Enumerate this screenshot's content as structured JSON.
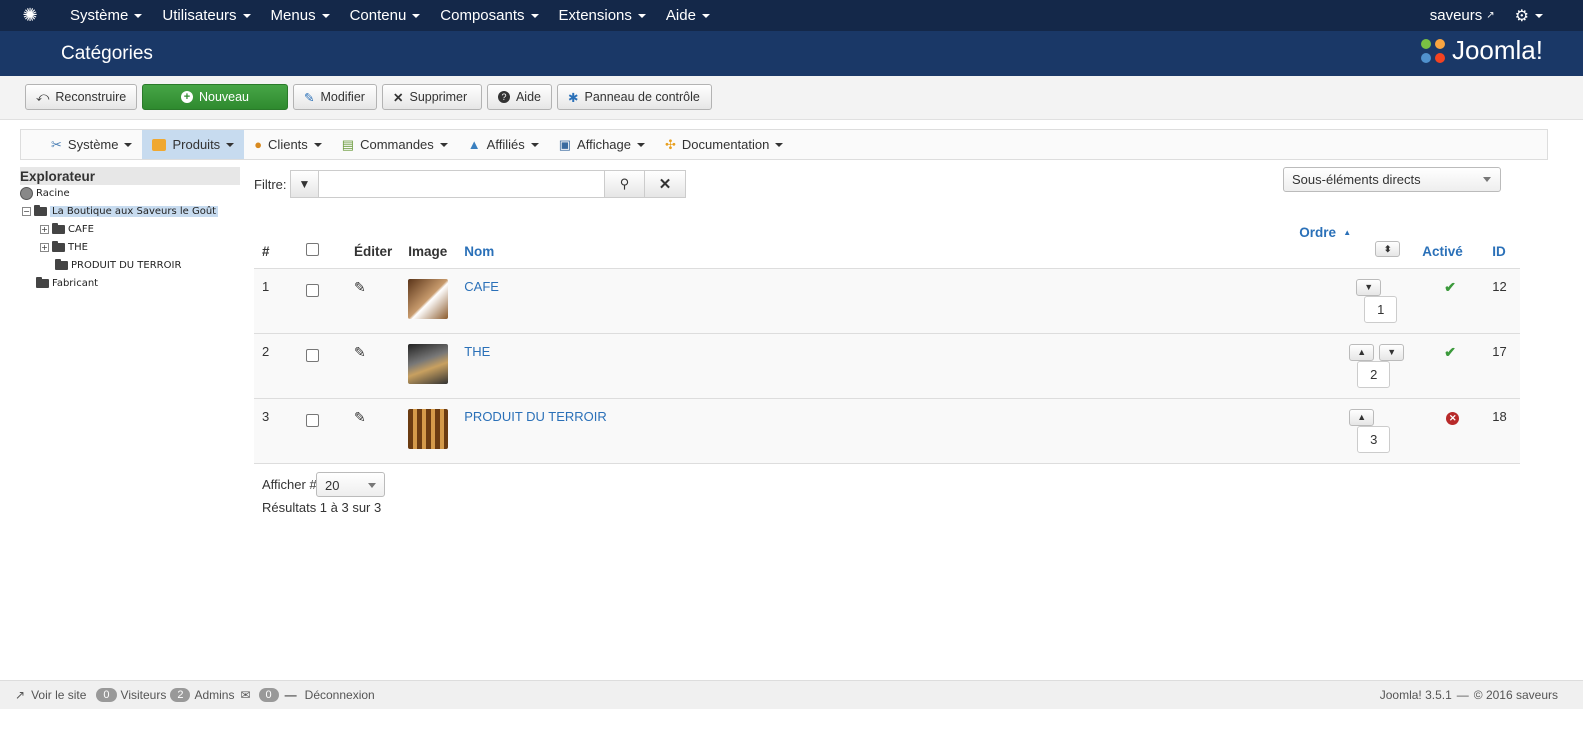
{
  "nav": {
    "items": [
      "Système",
      "Utilisateurs",
      "Menus",
      "Contenu",
      "Composants",
      "Extensions",
      "Aide"
    ],
    "site": "saveurs"
  },
  "header": {
    "title": "Catégories",
    "brand": "Joomla!"
  },
  "toolbar": {
    "rebuild": "Reconstruire",
    "new": "Nouveau",
    "edit": "Modifier",
    "delete": "Supprimer",
    "help": "Aide",
    "panel": "Panneau de contrôle"
  },
  "submenu": [
    "Système",
    "Produits",
    "Clients",
    "Commandes",
    "Affiliés",
    "Affichage",
    "Documentation"
  ],
  "sidebar": {
    "title": "Explorateur",
    "root": "Racine",
    "shop": "La Boutique aux Saveurs le Goût",
    "children": [
      "CAFE",
      "THE",
      "PRODUIT DU TERROIR"
    ],
    "maker": "Fabricant"
  },
  "filter": {
    "label": "Filtre:",
    "value": ""
  },
  "select": {
    "selected": "Sous-éléments directs"
  },
  "table": {
    "headers": {
      "num": "#",
      "edit": "Éditer",
      "image": "Image",
      "name": "Nom",
      "order": "Ordre",
      "active": "Activé",
      "id": "ID"
    },
    "rows": [
      {
        "num": "1",
        "name": "CAFE",
        "order": "1",
        "id": "12",
        "active": true
      },
      {
        "num": "2",
        "name": "THE",
        "order": "2",
        "id": "17",
        "active": true
      },
      {
        "num": "3",
        "name": "PRODUIT DU TERROIR",
        "order": "3",
        "id": "18",
        "active": false
      }
    ]
  },
  "pager": {
    "label": "Afficher #",
    "value": "20",
    "results": "Résultats 1 à 3 sur 3"
  },
  "footer": {
    "view": "Voir le site",
    "visitors_count": "0",
    "visitors": "Visiteurs",
    "admins_count": "2",
    "admins": "Admins",
    "msg_count": "0",
    "logout": "Déconnexion",
    "version": "Joomla! 3.5.1",
    "sep": "—",
    "copy": "© 2016 saveurs"
  }
}
